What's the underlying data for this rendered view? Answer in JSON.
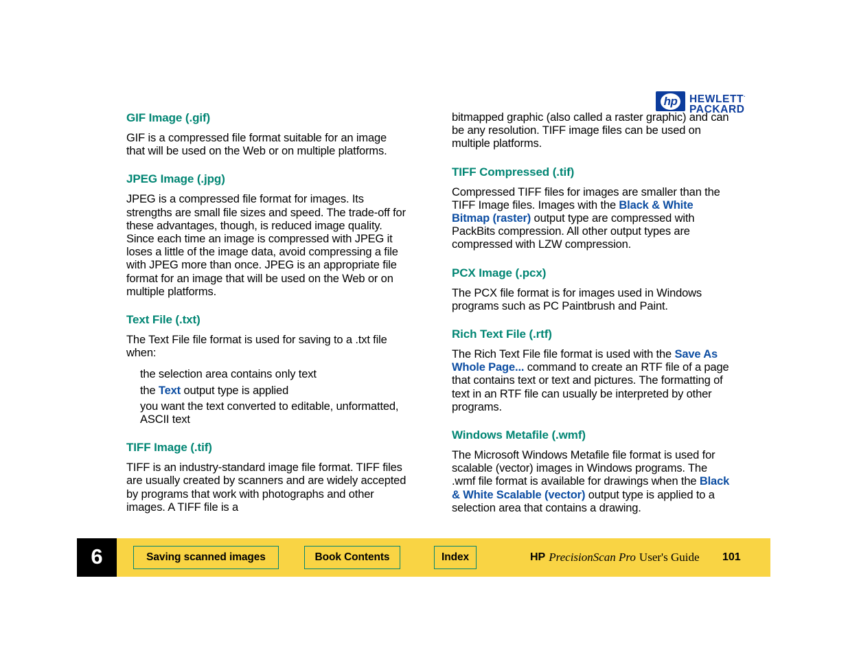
{
  "logo": {
    "mark_text": "hp",
    "line1": "HEWLETT",
    "trademark": "·",
    "line2": "PACKARD",
    "color": "#0C3C9C"
  },
  "colors": {
    "heading_teal": "#008573",
    "link_blue": "#0C4DA2",
    "footer_yellow": "#F9D444",
    "chapter_black": "#000000"
  },
  "left_column": {
    "sections": [
      {
        "heading": "GIF Image (.gif)",
        "paragraph": "GIF is a compressed file format suitable for an image that will be used on the Web or on multiple platforms."
      },
      {
        "heading": "JPEG Image (.jpg)",
        "paragraph": "JPEG is a compressed file format for images. Its strengths are small file sizes and speed. The trade-off for these advantages, though, is reduced image quality. Since each time an image is compressed with JPEG it loses a little of the image data, avoid compressing a file with JPEG more than once. JPEG is an appropriate file format for an image that will be used on the Web or on multiple platforms."
      },
      {
        "heading": "Text File (.txt)",
        "paragraph": "The Text File file format is used for saving to a .txt file when:",
        "items": [
          {
            "pre": "the selection area contains only text",
            "link": "",
            "post": ""
          },
          {
            "pre": "the ",
            "link": "Text",
            "post": " output type is applied"
          },
          {
            "pre": "you want the text converted to editable, unformatted, ASCII text",
            "link": "",
            "post": ""
          }
        ]
      },
      {
        "heading": "TIFF Image (.tif)",
        "paragraph": "TIFF is an industry-standard image file format. TIFF files are usually created by scanners and are widely accepted by programs that work with photographs and other images. A TIFF file is a"
      }
    ]
  },
  "right_column": {
    "continuation": "bitmapped graphic (also called a raster graphic) and can be any resolution. TIFF image files can be used on multiple platforms.",
    "sections": [
      {
        "heading": "TIFF Compressed (.tif)",
        "pre": "Compressed TIFF files for images are smaller than the TIFF Image files. Images with the ",
        "link": "Black & White Bitmap (raster)",
        "post": " output type are compressed with PackBits compression. All other output types are compressed with LZW compression."
      },
      {
        "heading": "PCX Image (.pcx)",
        "pre": "The PCX file format is for images used in Windows programs such as PC Paintbrush and Paint.",
        "link": "",
        "post": ""
      },
      {
        "heading": "Rich Text File (.rtf)",
        "pre": "The Rich Text File file format is used with the ",
        "link": "Save As Whole Page...",
        "post": " command to create an RTF file of a page that contains text or text and pictures. The formatting of text in an RTF file can usually be interpreted by other programs."
      },
      {
        "heading": "Windows Metafile (.wmf)",
        "pre": "The Microsoft Windows Metafile file format is used for scalable (vector) images in Windows programs. The .wmf file format is available for drawings when the ",
        "link": "Black & White Scalable (vector)",
        "post": " output type is applied to a selection area that contains a drawing."
      }
    ]
  },
  "footer": {
    "chapter_number": "6",
    "chapter_title_button": "Saving scanned images",
    "book_contents_button": "Book Contents",
    "index_button": "Index",
    "brand": "HP",
    "product": "PrecisionScan Pro",
    "guide": "User's Guide",
    "page_number": "101"
  }
}
